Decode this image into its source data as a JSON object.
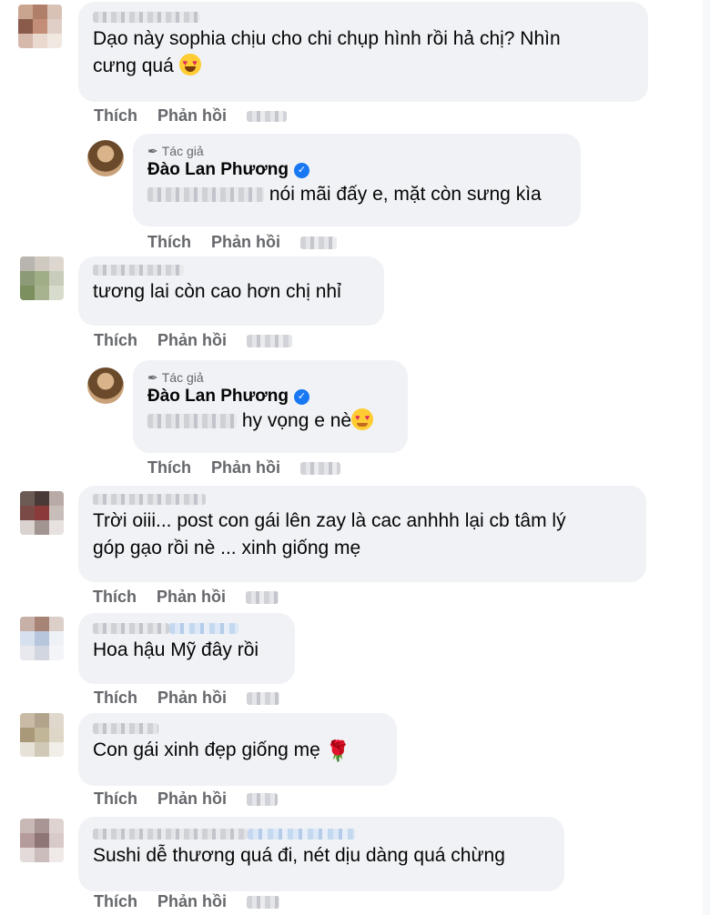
{
  "comments": [
    {
      "text_lines": [
        "Dạo này sophia chịu cho chi chụp hình rồi hả chị? Nhìn",
        "cưng quá"
      ],
      "emoji": "heart-eyes-face"
    },
    {
      "text_lines": [
        "tương lai còn cao hơn chị nhỉ"
      ]
    },
    {
      "text_lines": [
        "Trời oiii... post con gái lên zay là cac anhhh lại cb tâm lý",
        "góp gạo rồi nè ... xinh giống mẹ"
      ]
    },
    {
      "text_lines": [
        "Hoa hậu Mỹ đây rồi"
      ]
    },
    {
      "text_lines": [
        "Con gái xinh đẹp giống mẹ"
      ],
      "emoji": "rose"
    },
    {
      "text_lines": [
        "Sushi dễ thương quá đi, nét dịu dàng quá chừng"
      ]
    }
  ],
  "replies": [
    {
      "author_tag": "Tác giả",
      "author": "Đào Lan Phương",
      "text": "nói mãi đấy e, mặt còn sưng kìa"
    },
    {
      "author_tag": "Tác giả",
      "author": "Đào Lan Phương",
      "text": "hy vọng e nè",
      "emoji": "smiling-face-with-hearts"
    }
  ],
  "actions": {
    "like": "Thích",
    "reply": "Phản hồi"
  },
  "colors": {
    "bubble": "#f0f2f5",
    "action_text": "#65676b",
    "verified": "#1877f2"
  }
}
